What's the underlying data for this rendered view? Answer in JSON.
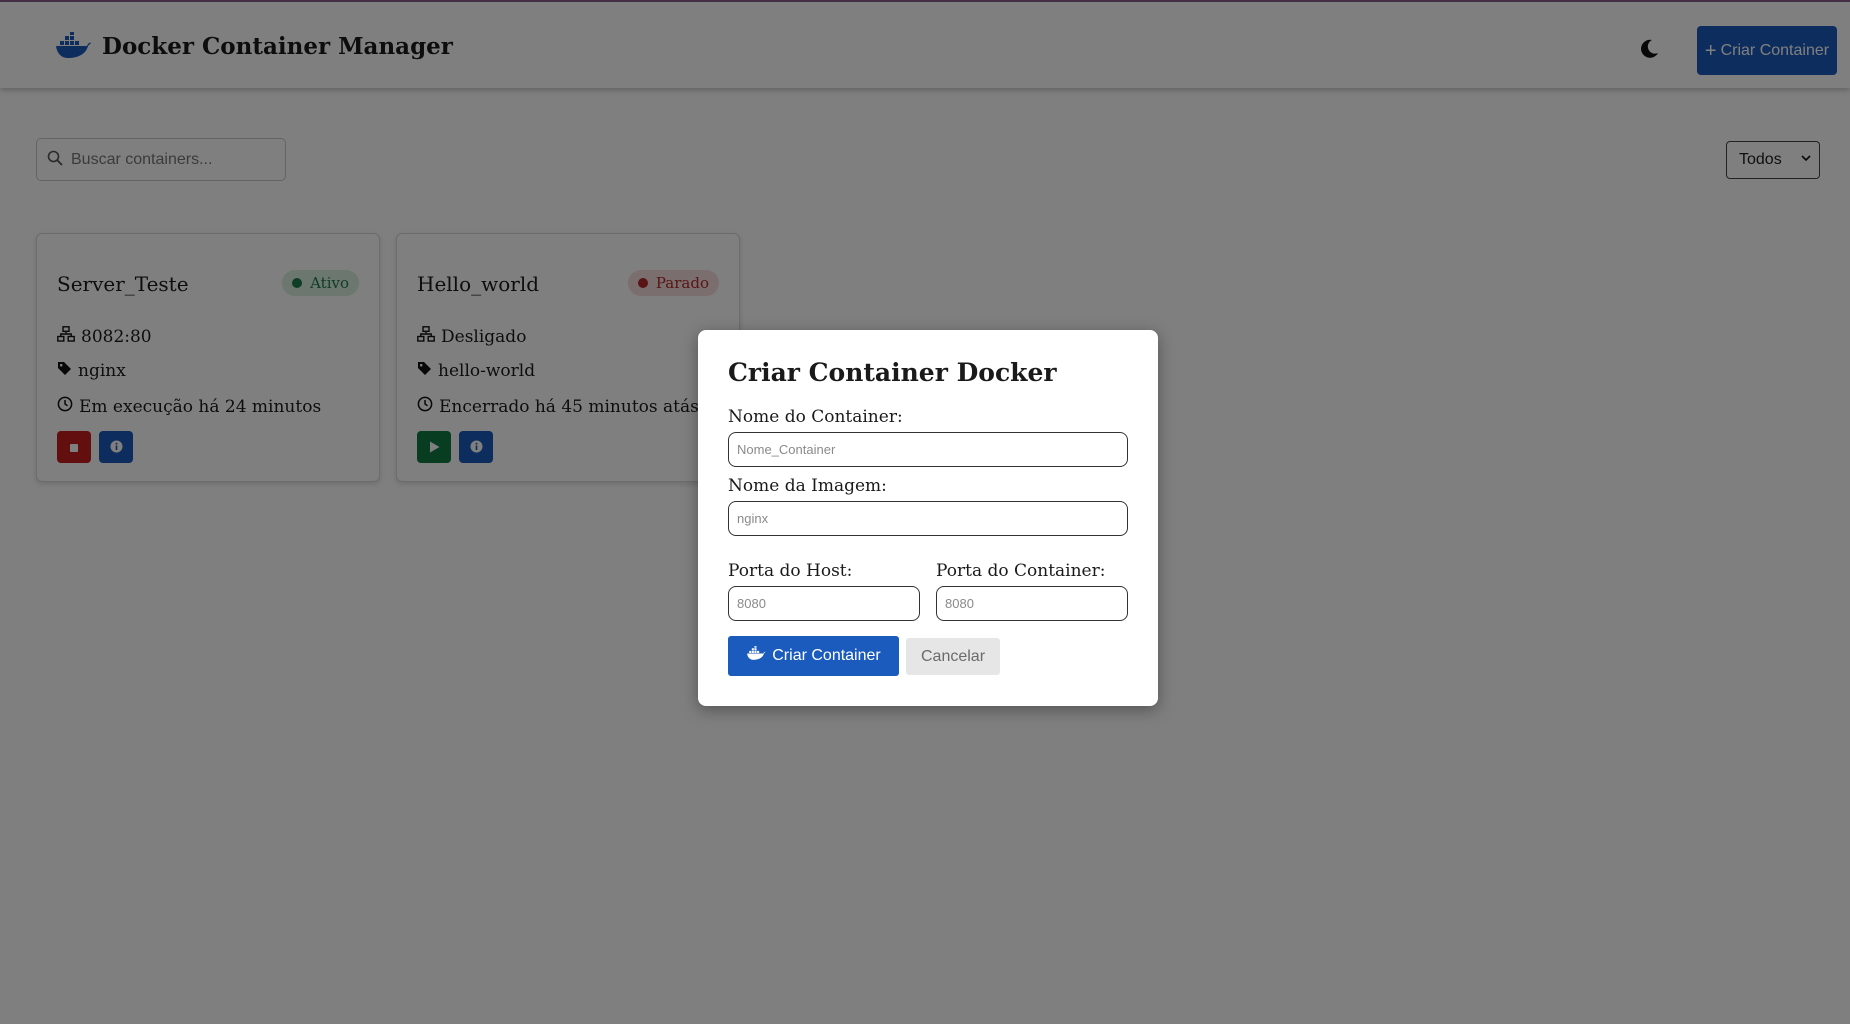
{
  "header": {
    "title": "Docker Container Manager",
    "create_button_label": "Criar Container"
  },
  "search": {
    "placeholder": "Buscar containers...",
    "value": ""
  },
  "filter": {
    "selected": "Todos"
  },
  "containers": [
    {
      "name": "Server_Teste",
      "status": "Ativo",
      "ports": "8082:80",
      "image": "nginx",
      "uptime": "Em execução há 24 minutos"
    },
    {
      "name": "Hello_world",
      "status": "Parado",
      "ports": "Desligado",
      "image": "hello-world",
      "uptime": "Encerrado há 45 minutos atás"
    }
  ],
  "modal": {
    "title": "Criar Container Docker",
    "name_label": "Nome do Container:",
    "name_placeholder": "Nome_Container",
    "image_label": "Nome da Imagem:",
    "image_placeholder": "nginx",
    "host_port_label": "Porta do Host:",
    "host_port_placeholder": "8080",
    "container_port_label": "Porta do Container:",
    "container_port_placeholder": "8080",
    "create_label": "Criar Container",
    "cancel_label": "Cancelar"
  },
  "colors": {
    "primary": "#1a5bbd",
    "danger": "#c81e1e",
    "success": "#127a45",
    "active_badge_bg": "#d6eedf",
    "stopped_badge_bg": "#f7dcdc"
  },
  "icons": [
    "docker-icon",
    "moon-icon",
    "plus-icon",
    "search-icon",
    "chevron-down-icon",
    "network-icon",
    "tag-icon",
    "clock-icon",
    "stop-icon",
    "play-icon",
    "info-icon"
  ]
}
